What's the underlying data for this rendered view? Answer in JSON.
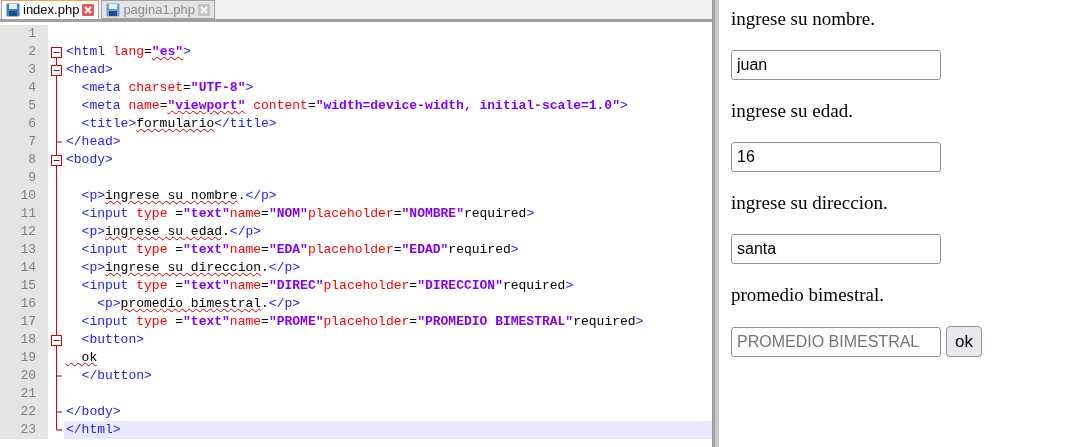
{
  "editor": {
    "tabs": [
      {
        "label": "index.php",
        "selected": true
      },
      {
        "label": "pagina1.php",
        "selected": false
      }
    ],
    "lines": [
      {
        "number": "1",
        "current": false
      },
      {
        "number": "2",
        "foldable": true,
        "current": false,
        "segments": [
          {
            "kind": "tag",
            "text": "<html"
          },
          {
            "kind": "attr",
            "text": " lang"
          },
          {
            "kind": "punct",
            "text": "="
          },
          {
            "kind": "value",
            "text": "\"es\"",
            "misspelled": true
          },
          {
            "kind": "tag",
            "text": ">"
          }
        ]
      },
      {
        "number": "3",
        "foldable": true,
        "current": false,
        "segments": [
          {
            "kind": "tag",
            "text": "<head>"
          }
        ]
      },
      {
        "number": "4",
        "current": false,
        "segments": [
          {
            "kind": "tag",
            "text": "  <meta"
          },
          {
            "kind": "attr",
            "text": " charset"
          },
          {
            "kind": "punct",
            "text": "="
          },
          {
            "kind": "value",
            "text": "\"UTF-8\""
          },
          {
            "kind": "tag",
            "text": ">"
          }
        ]
      },
      {
        "number": "5",
        "current": false,
        "segments": [
          {
            "kind": "tag",
            "text": "  <meta"
          },
          {
            "kind": "attr",
            "text": " name"
          },
          {
            "kind": "punct",
            "text": "="
          },
          {
            "kind": "value",
            "text": "\"viewport\"",
            "misspelled": true
          },
          {
            "kind": "attr",
            "text": " content"
          },
          {
            "kind": "punct",
            "text": "="
          },
          {
            "kind": "value",
            "text": "\"width=device-width, initial-scale=1.0\""
          },
          {
            "kind": "tag",
            "text": ">"
          }
        ]
      },
      {
        "number": "6",
        "current": false,
        "segments": [
          {
            "kind": "tag",
            "text": "  <title>"
          },
          {
            "kind": "text",
            "text": "formulario",
            "misspelled": true
          },
          {
            "kind": "tag",
            "text": "</title>"
          }
        ]
      },
      {
        "number": "7",
        "fold_end": true,
        "current": false,
        "segments": [
          {
            "kind": "tag",
            "text": "</head>"
          }
        ]
      },
      {
        "number": "8",
        "foldable": true,
        "current": false,
        "segments": [
          {
            "kind": "tag",
            "text": "<body>"
          }
        ]
      },
      {
        "number": "9",
        "current": false
      },
      {
        "number": "10",
        "current": false,
        "segments": [
          {
            "kind": "tag",
            "text": "  <p>"
          },
          {
            "kind": "text",
            "text": "ingrese su nombre",
            "misspelled": true
          },
          {
            "kind": "text",
            "text": "."
          },
          {
            "kind": "tag",
            "text": "</p>"
          }
        ]
      },
      {
        "number": "11",
        "current": false,
        "segments": [
          {
            "kind": "tag",
            "text": "  <input"
          },
          {
            "kind": "attr",
            "text": " type "
          },
          {
            "kind": "punct",
            "text": "="
          },
          {
            "kind": "value",
            "text": "\"text\""
          },
          {
            "kind": "attr",
            "text": "name"
          },
          {
            "kind": "punct",
            "text": "="
          },
          {
            "kind": "value",
            "text": "\"NOM\""
          },
          {
            "kind": "attr",
            "text": "placeholder"
          },
          {
            "kind": "punct",
            "text": "="
          },
          {
            "kind": "value",
            "text": "\"NOMBRE\""
          },
          {
            "kind": "text",
            "text": "required"
          },
          {
            "kind": "tag",
            "text": ">"
          }
        ]
      },
      {
        "number": "12",
        "current": false,
        "segments": [
          {
            "kind": "tag",
            "text": "  <p>"
          },
          {
            "kind": "text",
            "text": "ingrese su edad",
            "misspelled": true
          },
          {
            "kind": "text",
            "text": "."
          },
          {
            "kind": "tag",
            "text": "</p>"
          }
        ]
      },
      {
        "number": "13",
        "current": false,
        "segments": [
          {
            "kind": "tag",
            "text": "  <input"
          },
          {
            "kind": "attr",
            "text": " type "
          },
          {
            "kind": "punct",
            "text": "="
          },
          {
            "kind": "value",
            "text": "\"text\""
          },
          {
            "kind": "attr",
            "text": "name"
          },
          {
            "kind": "punct",
            "text": "="
          },
          {
            "kind": "value",
            "text": "\"EDA\""
          },
          {
            "kind": "attr",
            "text": "placeholder"
          },
          {
            "kind": "punct",
            "text": "="
          },
          {
            "kind": "value",
            "text": "\"EDAD\""
          },
          {
            "kind": "text",
            "text": "required"
          },
          {
            "kind": "tag",
            "text": ">"
          }
        ]
      },
      {
        "number": "14",
        "current": false,
        "segments": [
          {
            "kind": "tag",
            "text": "  <p>"
          },
          {
            "kind": "text",
            "text": "ingrese su direccion",
            "misspelled": true
          },
          {
            "kind": "text",
            "text": "."
          },
          {
            "kind": "tag",
            "text": "</p>"
          }
        ]
      },
      {
        "number": "15",
        "current": false,
        "segments": [
          {
            "kind": "tag",
            "text": "  <input"
          },
          {
            "kind": "attr",
            "text": " type "
          },
          {
            "kind": "punct",
            "text": "="
          },
          {
            "kind": "value",
            "text": "\"text\""
          },
          {
            "kind": "attr",
            "text": "name"
          },
          {
            "kind": "punct",
            "text": "="
          },
          {
            "kind": "value",
            "text": "\"DIREC\""
          },
          {
            "kind": "attr",
            "text": "placeholder"
          },
          {
            "kind": "punct",
            "text": "="
          },
          {
            "kind": "value",
            "text": "\"DIRECCION\""
          },
          {
            "kind": "text",
            "text": "required"
          },
          {
            "kind": "tag",
            "text": ">"
          }
        ]
      },
      {
        "number": "16",
        "current": false,
        "segments": [
          {
            "kind": "tag",
            "text": "    <p>"
          },
          {
            "kind": "text",
            "text": "promedio bimestral",
            "misspelled": true
          },
          {
            "kind": "text",
            "text": "."
          },
          {
            "kind": "tag",
            "text": "</p>"
          }
        ]
      },
      {
        "number": "17",
        "current": false,
        "segments": [
          {
            "kind": "tag",
            "text": "  <input"
          },
          {
            "kind": "attr",
            "text": " type "
          },
          {
            "kind": "punct",
            "text": "="
          },
          {
            "kind": "value",
            "text": "\"text\""
          },
          {
            "kind": "attr",
            "text": "name"
          },
          {
            "kind": "punct",
            "text": "="
          },
          {
            "kind": "value",
            "text": "\"PROME\""
          },
          {
            "kind": "attr",
            "text": "placeholder"
          },
          {
            "kind": "punct",
            "text": "="
          },
          {
            "kind": "value",
            "text": "\"PROMEDIO BIMESTRAL\""
          },
          {
            "kind": "text",
            "text": "required"
          },
          {
            "kind": "tag",
            "text": ">"
          }
        ]
      },
      {
        "number": "18",
        "foldable": true,
        "current": false,
        "segments": [
          {
            "kind": "tag",
            "text": "  <button>"
          }
        ]
      },
      {
        "number": "19",
        "current": false,
        "segments": [
          {
            "kind": "text",
            "text": "  ok",
            "misspelled": true
          }
        ]
      },
      {
        "number": "20",
        "fold_end": true,
        "current": false,
        "segments": [
          {
            "kind": "tag",
            "text": "  </button>"
          }
        ]
      },
      {
        "number": "21",
        "current": false
      },
      {
        "number": "22",
        "fold_end": true,
        "current": false,
        "segments": [
          {
            "kind": "tag",
            "text": "</body>"
          }
        ]
      },
      {
        "number": "23",
        "fold_end": true,
        "current": true,
        "segments": [
          {
            "kind": "tag",
            "text": "</html>"
          }
        ]
      }
    ]
  },
  "preview": {
    "fields": [
      {
        "label": "ingrese su nombre.",
        "value": "juan"
      },
      {
        "label": "ingrese su edad.",
        "value": "16"
      },
      {
        "label": "ingrese su direccion.",
        "value": "santa"
      },
      {
        "label": "promedio bimestral.",
        "placeholder": "PROMEDIO BIMESTRAL"
      }
    ],
    "button": "ok"
  }
}
